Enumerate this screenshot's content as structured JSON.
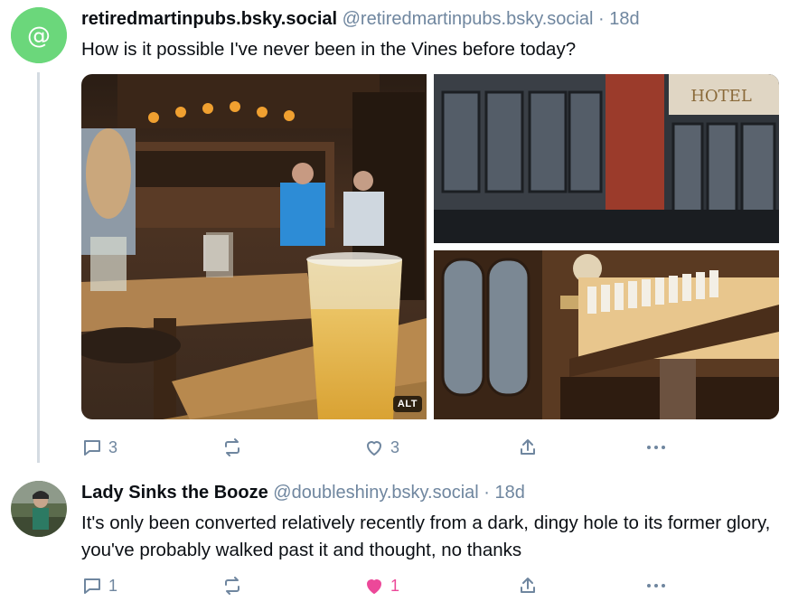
{
  "post1": {
    "display_name": "retiredmartinpubs.bsky.social",
    "handle": "@retiredmartinpubs.bsky.social",
    "separator": "·",
    "age": "18d",
    "text": "How is it possible I've never been in the Vines before today?",
    "alt_badge": "ALT",
    "reply_count": "3",
    "like_count": "3",
    "liked": false
  },
  "post2": {
    "display_name": "Lady Sinks the Booze",
    "handle": "@doubleshiny.bsky.social",
    "separator": "·",
    "age": "18d",
    "text": "It's only been converted relatively recently from a dark, dingy hole to its former glory, you've probably walked past it and thought,  no thanks",
    "reply_count": "1",
    "like_count": "1",
    "liked": true
  },
  "icons": {
    "reply": "comment-icon",
    "repost": "repost-icon",
    "like": "heart-icon",
    "share": "share-icon",
    "more": "ellipsis-icon",
    "avatar1": "at-sign-icon"
  },
  "colors": {
    "avatar1_bg": "#6bd77b",
    "muted": "#6f869f",
    "like_active": "#ec4899",
    "thread_line": "#d4dbe2"
  }
}
